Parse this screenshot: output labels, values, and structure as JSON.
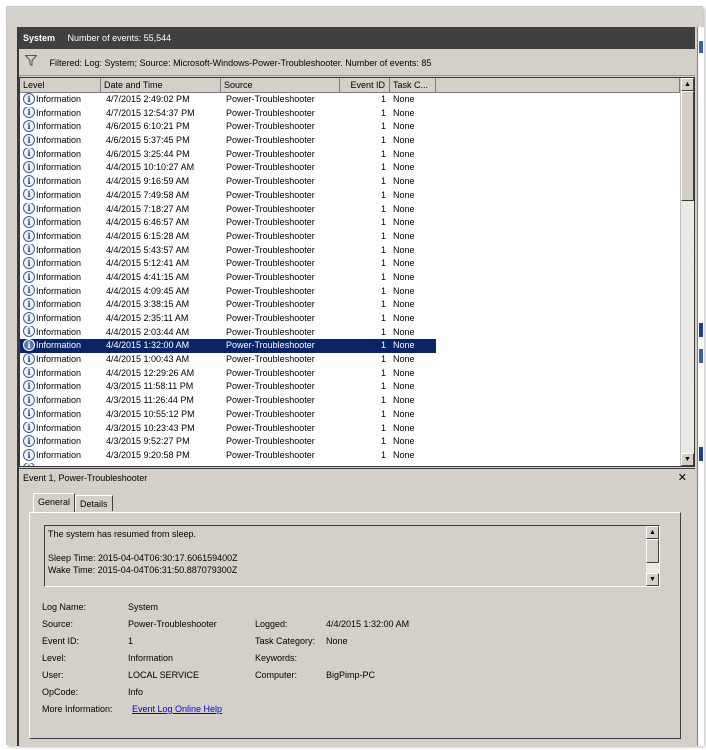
{
  "log_header": {
    "log_name": "System",
    "event_count_label": "Number of events: 55,544"
  },
  "filter": {
    "icon": "filter-funnel-icon",
    "text": "Filtered: Log: System; Source: Microsoft-Windows-Power-Troubleshooter. Number of events: 85"
  },
  "grid": {
    "columns": [
      "Level",
      "Date and Time",
      "Source",
      "Event ID",
      "Task C..."
    ],
    "selected_index": 18,
    "rows": [
      {
        "level": "Information",
        "datetime": "4/7/2015 2:49:02 PM",
        "source": "Power-Troubleshooter",
        "event_id": "1",
        "task": "None"
      },
      {
        "level": "Information",
        "datetime": "4/7/2015 12:54:37 PM",
        "source": "Power-Troubleshooter",
        "event_id": "1",
        "task": "None"
      },
      {
        "level": "Information",
        "datetime": "4/6/2015 6:10:21 PM",
        "source": "Power-Troubleshooter",
        "event_id": "1",
        "task": "None"
      },
      {
        "level": "Information",
        "datetime": "4/6/2015 5:37:45 PM",
        "source": "Power-Troubleshooter",
        "event_id": "1",
        "task": "None"
      },
      {
        "level": "Information",
        "datetime": "4/6/2015 3:25:44 PM",
        "source": "Power-Troubleshooter",
        "event_id": "1",
        "task": "None"
      },
      {
        "level": "Information",
        "datetime": "4/4/2015 10:10:27 AM",
        "source": "Power-Troubleshooter",
        "event_id": "1",
        "task": "None"
      },
      {
        "level": "Information",
        "datetime": "4/4/2015 9:16:59 AM",
        "source": "Power-Troubleshooter",
        "event_id": "1",
        "task": "None"
      },
      {
        "level": "Information",
        "datetime": "4/4/2015 7:49:58 AM",
        "source": "Power-Troubleshooter",
        "event_id": "1",
        "task": "None"
      },
      {
        "level": "Information",
        "datetime": "4/4/2015 7:18:27 AM",
        "source": "Power-Troubleshooter",
        "event_id": "1",
        "task": "None"
      },
      {
        "level": "Information",
        "datetime": "4/4/2015 6:46:57 AM",
        "source": "Power-Troubleshooter",
        "event_id": "1",
        "task": "None"
      },
      {
        "level": "Information",
        "datetime": "4/4/2015 6:15:28 AM",
        "source": "Power-Troubleshooter",
        "event_id": "1",
        "task": "None"
      },
      {
        "level": "Information",
        "datetime": "4/4/2015 5:43:57 AM",
        "source": "Power-Troubleshooter",
        "event_id": "1",
        "task": "None"
      },
      {
        "level": "Information",
        "datetime": "4/4/2015 5:12:41 AM",
        "source": "Power-Troubleshooter",
        "event_id": "1",
        "task": "None"
      },
      {
        "level": "Information",
        "datetime": "4/4/2015 4:41:15 AM",
        "source": "Power-Troubleshooter",
        "event_id": "1",
        "task": "None"
      },
      {
        "level": "Information",
        "datetime": "4/4/2015 4:09:45 AM",
        "source": "Power-Troubleshooter",
        "event_id": "1",
        "task": "None"
      },
      {
        "level": "Information",
        "datetime": "4/4/2015 3:38:15 AM",
        "source": "Power-Troubleshooter",
        "event_id": "1",
        "task": "None"
      },
      {
        "level": "Information",
        "datetime": "4/4/2015 2:35:11 AM",
        "source": "Power-Troubleshooter",
        "event_id": "1",
        "task": "None"
      },
      {
        "level": "Information",
        "datetime": "4/4/2015 2:03:44 AM",
        "source": "Power-Troubleshooter",
        "event_id": "1",
        "task": "None"
      },
      {
        "level": "Information",
        "datetime": "4/4/2015 1:32:00 AM",
        "source": "Power-Troubleshooter",
        "event_id": "1",
        "task": "None"
      },
      {
        "level": "Information",
        "datetime": "4/4/2015 1:00:43 AM",
        "source": "Power-Troubleshooter",
        "event_id": "1",
        "task": "None"
      },
      {
        "level": "Information",
        "datetime": "4/4/2015 12:29:26 AM",
        "source": "Power-Troubleshooter",
        "event_id": "1",
        "task": "None"
      },
      {
        "level": "Information",
        "datetime": "4/3/2015 11:58:11 PM",
        "source": "Power-Troubleshooter",
        "event_id": "1",
        "task": "None"
      },
      {
        "level": "Information",
        "datetime": "4/3/2015 11:26:44 PM",
        "source": "Power-Troubleshooter",
        "event_id": "1",
        "task": "None"
      },
      {
        "level": "Information",
        "datetime": "4/3/2015 10:55:12 PM",
        "source": "Power-Troubleshooter",
        "event_id": "1",
        "task": "None"
      },
      {
        "level": "Information",
        "datetime": "4/3/2015 10:23:43 PM",
        "source": "Power-Troubleshooter",
        "event_id": "1",
        "task": "None"
      },
      {
        "level": "Information",
        "datetime": "4/3/2015 9:52:27 PM",
        "source": "Power-Troubleshooter",
        "event_id": "1",
        "task": "None"
      },
      {
        "level": "Information",
        "datetime": "4/3/2015 9:20:58 PM",
        "source": "Power-Troubleshooter",
        "event_id": "1",
        "task": "None"
      }
    ]
  },
  "detail": {
    "title": "Event 1, Power-Troubleshooter",
    "close_icon": "close-icon",
    "tabs": [
      {
        "label": "General",
        "active": true
      },
      {
        "label": "Details",
        "active": false
      }
    ],
    "message_lines": [
      "The system has resumed from sleep.",
      "",
      "Sleep Time: 2015-04-04T06:30:17.606159400Z",
      "Wake Time: 2015-04-04T06:31:50.887079300Z"
    ],
    "properties": {
      "log_name_label": "Log Name:",
      "log_name": "System",
      "source_label": "Source:",
      "source": "Power-Troubleshooter",
      "logged_label": "Logged:",
      "logged": "4/4/2015 1:32:00 AM",
      "event_id_label": "Event ID:",
      "event_id": "1",
      "task_category_label": "Task Category:",
      "task_category": "None",
      "level_label": "Level:",
      "level": "Information",
      "keywords_label": "Keywords:",
      "keywords": "",
      "user_label": "User:",
      "user": "LOCAL SERVICE",
      "computer_label": "Computer:",
      "computer": "BigPimp-PC",
      "opcode_label": "OpCode:",
      "opcode": "Info",
      "more_info_label": "More Information:",
      "more_info_link": "Event Log Online Help"
    }
  },
  "colors": {
    "selection": "#0a246a",
    "header_bar": "#404040",
    "panel": "#d4d0c8",
    "link": "#0000ee"
  }
}
